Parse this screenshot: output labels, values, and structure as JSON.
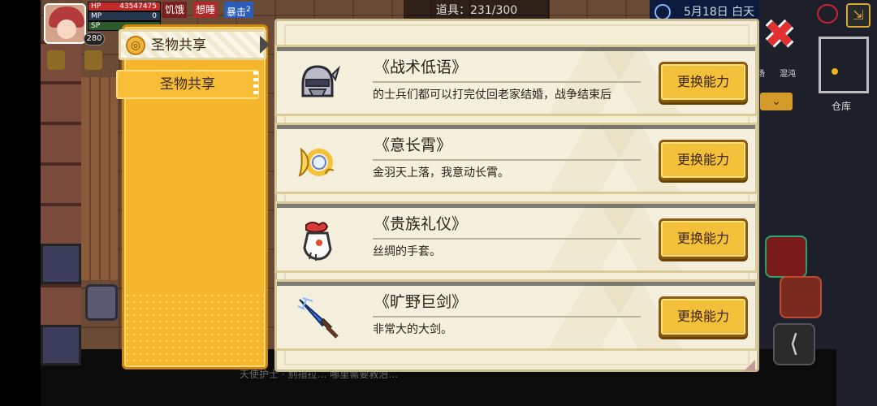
{
  "hud": {
    "hp_label": "HP",
    "hp_value": "43547475",
    "mp_label": "MP",
    "mp_value": "0",
    "sp_label": "SP",
    "level": "280",
    "status_hunger": "饥饿",
    "status_sleep": "想睡",
    "status_crit": "暴击",
    "crit_count": "2",
    "items": "道具：231/300",
    "date": "5月18日 白天",
    "warehouse": "仓库",
    "tag_a": "场",
    "tag_b": "混沌"
  },
  "tabs": {
    "top_label": "圣物共享",
    "sub_label": "圣物共享"
  },
  "abilities": [
    {
      "name": "《战术低语》",
      "desc": "的士兵们都可以打完仗回老家结婚，战争结束后",
      "button": "更换能力",
      "icon": "helmet-icon"
    },
    {
      "name": "《意长霄》",
      "desc": "金羽天上落，我意动长霄。",
      "button": "更换能力",
      "icon": "feather-ring-icon"
    },
    {
      "name": "《贵族礼仪》",
      "desc": "丝绸的手套。",
      "button": "更换能力",
      "icon": "glove-icon"
    },
    {
      "name": "《旷野巨剑》",
      "desc": "非常大的大剑。",
      "button": "更换能力",
      "icon": "greatsword-icon"
    }
  ],
  "bottom_hint": "天使护士 · 别指拉… 哪里需要救治…",
  "close_label": "✖",
  "exit_label": "⇲",
  "colors": {
    "panel_yellow": "#f6b62b",
    "card_bg": "#f5f0dd",
    "button": "#f3c03a",
    "close_red": "#e23030"
  }
}
